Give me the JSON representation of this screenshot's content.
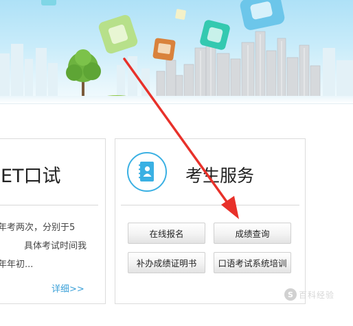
{
  "left_card": {
    "title": "ET口试",
    "lines": [
      "年考两次，分别于5",
      "具体考试时间我",
      "年年初..."
    ],
    "more_link": "详细>>"
  },
  "service_card": {
    "icon": "contact-book-icon",
    "title": "考生服务",
    "buttons": [
      "在线报名",
      "成绩查询",
      "补办成绩证明书",
      "口语考试系统培训"
    ]
  },
  "annotation": {
    "color": "#e8312a"
  },
  "watermark": {
    "badge": "S",
    "text": "百科经验"
  },
  "colors": {
    "accent": "#3ab0e3",
    "link": "#3aa0d8"
  }
}
